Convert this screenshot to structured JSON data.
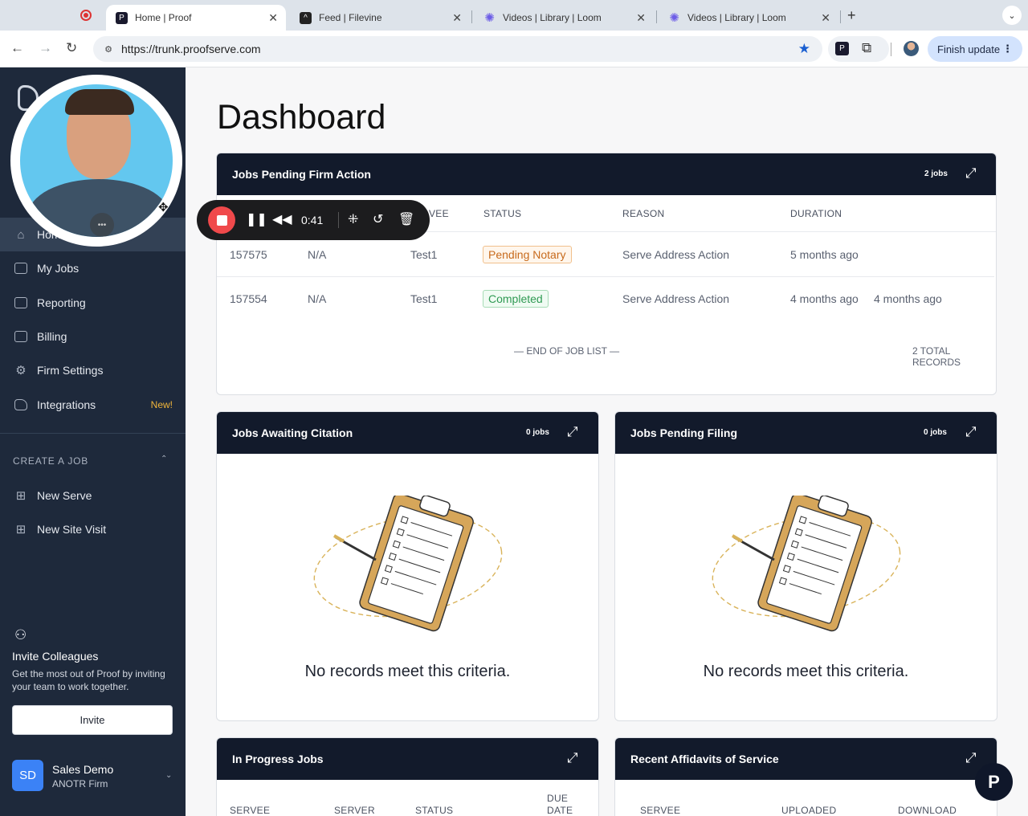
{
  "browser": {
    "tabs": [
      {
        "title": "Home | Proof"
      },
      {
        "title": "Feed | Filevine"
      },
      {
        "title": "Videos | Library | Loom"
      },
      {
        "title": "Videos | Library | Loom"
      }
    ],
    "url": "https://trunk.proofserve.com",
    "finish_update": "Finish update"
  },
  "sidebar": {
    "nav": [
      {
        "label": "Home",
        "icon": "home-icon"
      },
      {
        "label": "My Jobs",
        "icon": "briefcase-icon"
      },
      {
        "label": "Reporting",
        "icon": "chart-icon"
      },
      {
        "label": "Billing",
        "icon": "card-icon"
      },
      {
        "label": "Firm Settings",
        "icon": "gear-icon"
      },
      {
        "label": "Integrations",
        "icon": "puzzle-icon",
        "badge": "New!"
      }
    ],
    "create_section": "CREATE A JOB",
    "create_items": [
      {
        "label": "New Serve"
      },
      {
        "label": "New Site Visit"
      }
    ],
    "invite": {
      "title": "Invite Colleagues",
      "text": "Get the most out of Proof by inviting your team to work together.",
      "button": "Invite"
    },
    "user": {
      "initials": "SD",
      "name": "Sales Demo",
      "firm": "ANOTR Firm"
    }
  },
  "main": {
    "title": "Dashboard",
    "pending_firm": {
      "title": "Jobs Pending Firm Action",
      "count": "2 jobs",
      "headers": [
        "VEE",
        "STATUS",
        "REASON",
        "DURATION"
      ],
      "rows": [
        {
          "id": "157575",
          "server": "N/A",
          "servee": "Test1",
          "status": "Pending Notary",
          "status_kind": "pending",
          "reason": "Serve Address Action",
          "duration": "5 months ago",
          "extra": ""
        },
        {
          "id": "157554",
          "server": "N/A",
          "servee": "Test1",
          "status": "Completed",
          "status_kind": "done",
          "reason": "Serve Address Action",
          "duration": "4 months ago",
          "extra": "4 months ago"
        }
      ],
      "end_label": "— END OF JOB LIST —",
      "total_label": "2 TOTAL RECORDS"
    },
    "awaiting_citation": {
      "title": "Jobs Awaiting Citation",
      "count": "0 jobs",
      "empty": "No records meet this criteria."
    },
    "pending_filing": {
      "title": "Jobs Pending Filing",
      "count": "0 jobs",
      "empty": "No records meet this criteria."
    },
    "in_progress": {
      "title": "In Progress Jobs",
      "headers": [
        "SERVEE",
        "SERVER",
        "STATUS",
        "DUE",
        "DATE"
      ]
    },
    "affidavits": {
      "title": "Recent Affidavits of Service",
      "headers": [
        "SERVEE",
        "UPLOADED",
        "DOWNLOAD"
      ]
    }
  },
  "recorder": {
    "time": "0:41"
  },
  "colors": {
    "sidebar": "#1e293b",
    "card_header": "#121a2b",
    "record": "#f0494b",
    "pending": "#c76a1c",
    "completed": "#2f9a53"
  }
}
